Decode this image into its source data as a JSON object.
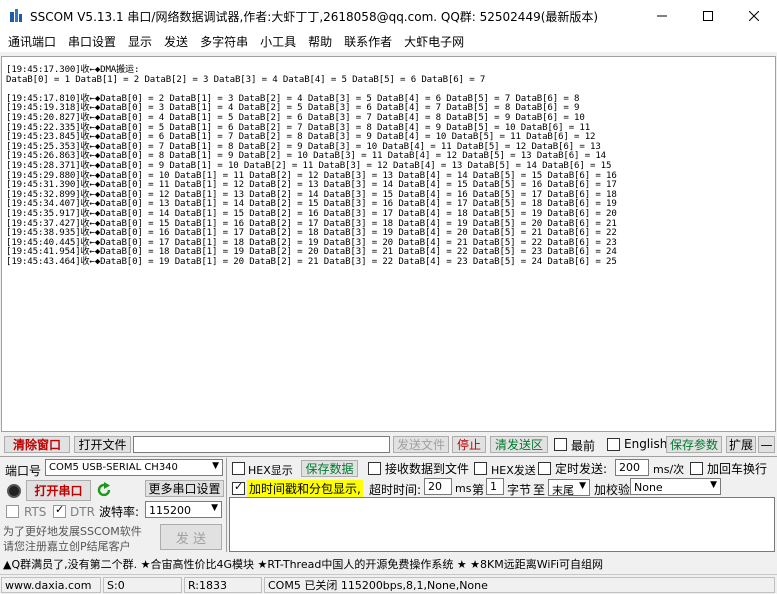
{
  "window": {
    "title": "SSCOM V5.13.1 串口/网络数据调试器,作者:大虾丁丁,2618058@qq.com. QQ群: 52502449(最新版本)"
  },
  "menu": [
    "通讯端口",
    "串口设置",
    "显示",
    "发送",
    "多字符串",
    "小工具",
    "帮助",
    "联系作者",
    "大虾电子网"
  ],
  "receive": {
    "lines": [
      "[19:45:17.300]收←◆DMA搬运:",
      "DataB[0] = 1 DataB[1] = 2 DataB[2] = 3 DataB[3] = 4 DataB[4] = 5 DataB[5] = 6 DataB[6] = 7",
      "",
      "[19:45:17.810]收←◆DataB[0] = 2 DataB[1] = 3 DataB[2] = 4 DataB[3] = 5 DataB[4] = 6 DataB[5] = 7 DataB[6] = 8",
      "[19:45:19.318]收←◆DataB[0] = 3 DataB[1] = 4 DataB[2] = 5 DataB[3] = 6 DataB[4] = 7 DataB[5] = 8 DataB[6] = 9",
      "[19:45:20.827]收←◆DataB[0] = 4 DataB[1] = 5 DataB[2] = 6 DataB[3] = 7 DataB[4] = 8 DataB[5] = 9 DataB[6] = 10",
      "[19:45:22.335]收←◆DataB[0] = 5 DataB[1] = 6 DataB[2] = 7 DataB[3] = 8 DataB[4] = 9 DataB[5] = 10 DataB[6] = 11",
      "[19:45:23.845]收←◆DataB[0] = 6 DataB[1] = 7 DataB[2] = 8 DataB[3] = 9 DataB[4] = 10 DataB[5] = 11 DataB[6] = 12",
      "[19:45:25.353]收←◆DataB[0] = 7 DataB[1] = 8 DataB[2] = 9 DataB[3] = 10 DataB[4] = 11 DataB[5] = 12 DataB[6] = 13",
      "[19:45:26.863]收←◆DataB[0] = 8 DataB[1] = 9 DataB[2] = 10 DataB[3] = 11 DataB[4] = 12 DataB[5] = 13 DataB[6] = 14",
      "[19:45:28.371]收←◆DataB[0] = 9 DataB[1] = 10 DataB[2] = 11 DataB[3] = 12 DataB[4] = 13 DataB[5] = 14 DataB[6] = 15",
      "[19:45:29.880]收←◆DataB[0] = 10 DataB[1] = 11 DataB[2] = 12 DataB[3] = 13 DataB[4] = 14 DataB[5] = 15 DataB[6] = 16",
      "[19:45:31.390]收←◆DataB[0] = 11 DataB[1] = 12 DataB[2] = 13 DataB[3] = 14 DataB[4] = 15 DataB[5] = 16 DataB[6] = 17",
      "[19:45:32.899]收←◆DataB[0] = 12 DataB[1] = 13 DataB[2] = 14 DataB[3] = 15 DataB[4] = 16 DataB[5] = 17 DataB[6] = 18",
      "[19:45:34.407]收←◆DataB[0] = 13 DataB[1] = 14 DataB[2] = 15 DataB[3] = 16 DataB[4] = 17 DataB[5] = 18 DataB[6] = 19",
      "[19:45:35.917]收←◆DataB[0] = 14 DataB[1] = 15 DataB[2] = 16 DataB[3] = 17 DataB[4] = 18 DataB[5] = 19 DataB[6] = 20",
      "[19:45:37.427]收←◆DataB[0] = 15 DataB[1] = 16 DataB[2] = 17 DataB[3] = 18 DataB[4] = 19 DataB[5] = 20 DataB[6] = 21",
      "[19:45:38.935]收←◆DataB[0] = 16 DataB[1] = 17 DataB[2] = 18 DataB[3] = 19 DataB[4] = 20 DataB[5] = 21 DataB[6] = 22",
      "[19:45:40.445]收←◆DataB[0] = 17 DataB[1] = 18 DataB[2] = 19 DataB[3] = 20 DataB[4] = 21 DataB[5] = 22 DataB[6] = 23",
      "[19:45:41.954]收←◆DataB[0] = 18 DataB[1] = 19 DataB[2] = 20 DataB[3] = 21 DataB[4] = 22 DataB[5] = 23 DataB[6] = 24",
      "[19:45:43.464]收←◆DataB[0] = 19 DataB[1] = 20 DataB[2] = 21 DataB[3] = 22 DataB[4] = 23 DataB[5] = 24 DataB[6] = 25"
    ]
  },
  "toolbar": {
    "clear_window": "清除窗口",
    "open_file": "打开文件",
    "send_file": "发送文件",
    "stop": "停止",
    "clear_send_area": "清发送区",
    "last": "最前",
    "english": "English",
    "save_params": "保存参数",
    "expand": "扩展",
    "expand_arrow": "—"
  },
  "port": {
    "label": "端口号",
    "value": "COM5 USB-SERIAL CH340",
    "open_port": "打开串口",
    "more_settings": "更多串口设置",
    "rts": "RTS",
    "dtr": "DTR",
    "baud_label": "波特率:",
    "baud_value": "115200",
    "promo_line1": "为了更好地发展SSCOM软件",
    "promo_line2": "请您注册嘉立创P结尾客户",
    "send": "发 送"
  },
  "options": {
    "hex_display": "HEX显示",
    "save_data": "保存数据",
    "receive_to_file": "接收数据到文件",
    "hex_send": "HEX发送",
    "timed_send": "定时发送:",
    "timed_value": "200",
    "timed_unit": "ms/次",
    "add_crlf": "加回车换行",
    "timestamp": "加时间戳和分包显示,",
    "timeout_label": "超时时间:",
    "timeout_value": "20",
    "timeout_unit": "ms",
    "byte_label": "第",
    "byte_value": "1",
    "byte_unit": "字节",
    "to": "至",
    "tail": "末尾",
    "checksum_label": "加校验",
    "checksum_value": "None"
  },
  "ticker": "▲Q群满员了,没有第二个群. ★合宙高性价比4G模块 ★RT-Thread中国人的开源免费操作系统 ★ ★8KM远距离WiFi可自组网",
  "status": {
    "website": "www.daxia.com",
    "sent": "S:0",
    "received": "R:1833",
    "port_status": "COM5 已关闭  115200bps,8,1,None,None"
  },
  "colors": {
    "accent_red": "#c00000",
    "accent_green": "#007a2e",
    "highlight_yellow": "#ffff00"
  }
}
